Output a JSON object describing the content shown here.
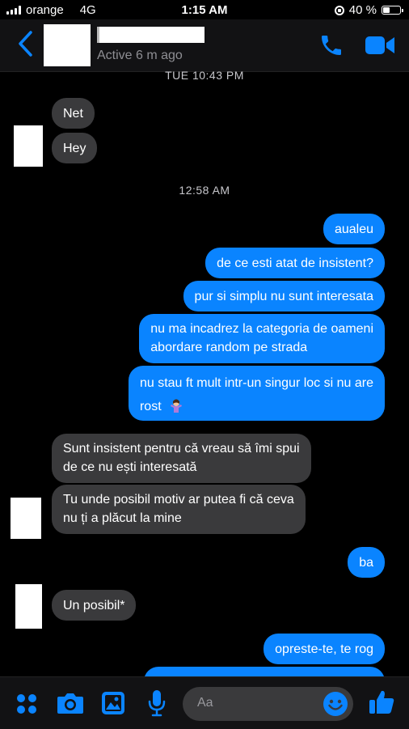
{
  "status_bar": {
    "carrier": "orange",
    "network": "4G",
    "time": "1:15 AM",
    "battery": "40 %",
    "battery_level": 0.4
  },
  "header": {
    "status": "Active 6 m ago"
  },
  "colors": {
    "accent": "#0a84ff",
    "incoming_bubble": "#3a3a3c",
    "background": "#000000"
  },
  "messages": {
    "ts1": "TUE 10:43 PM",
    "in1": "Net",
    "in2": "Hey",
    "ts2": "12:58 AM",
    "out1": "aualeu",
    "out2": "de ce esti atat de insistent?",
    "out3": "pur si simplu nu sunt interesata",
    "out4_line1": "nu ma incadrez la categoria de oameni",
    "out4_line2": "abordare random pe strada",
    "out5_line1": "nu stau ft mult intr-un singur loc si nu are",
    "out5_line2": "rost",
    "in3_line1": "Sunt insistent pentru că vreau să îmi spui",
    "in3_line2": "de ce nu ești interesată",
    "in4_line1": "Tu unde posibil motiv ar putea fi că ceva",
    "in4_line2": "nu ți a plăcut la mine",
    "out6": "ba",
    "in5": "Un posibil*",
    "out7": "opreste-te, te rog"
  },
  "composer": {
    "placeholder": "Aa"
  },
  "icons": [
    "back-icon",
    "phone-icon",
    "video-icon",
    "apps-icon",
    "camera-icon",
    "gallery-icon",
    "mic-icon",
    "emoji-icon",
    "thumbs-up-icon"
  ]
}
